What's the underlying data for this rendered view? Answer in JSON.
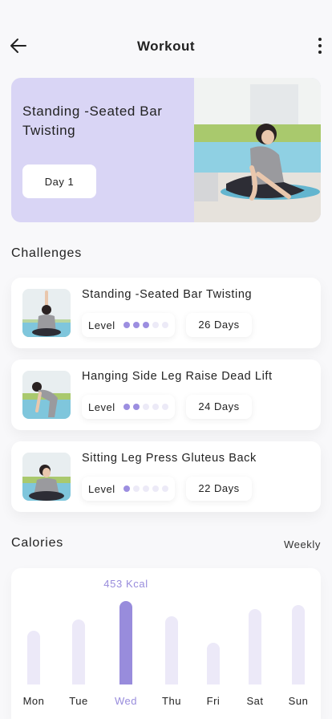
{
  "header": {
    "title": "Workout",
    "back_icon": "arrow-left-icon",
    "menu_icon": "more-vertical-icon"
  },
  "hero": {
    "title": "Standing -Seated Bar Twisting",
    "button_label": "Day 1",
    "color": "#d9d5f5"
  },
  "challenges": {
    "title": "Challenges",
    "level_label": "Level",
    "items": [
      {
        "name": "Standing -Seated Bar Twisting",
        "level": 3,
        "max_level": 5,
        "days": "26 Days"
      },
      {
        "name": "Hanging Side Leg Raise Dead Lift",
        "level": 2,
        "max_level": 5,
        "days": "24 Days"
      },
      {
        "name": "Sitting Leg Press Gluteus Back",
        "level": 1,
        "max_level": 5,
        "days": "22 Days"
      }
    ]
  },
  "calories": {
    "title": "Calories",
    "period": "Weekly",
    "highlight_label": "453 Kcal",
    "accent": "#988cdc"
  },
  "chart_data": {
    "type": "bar",
    "categories": [
      "Mon",
      "Tue",
      "Wed",
      "Thu",
      "Fri",
      "Sat",
      "Sun"
    ],
    "values": [
      0.64,
      0.78,
      1.0,
      0.82,
      0.5,
      0.9,
      0.95
    ],
    "highlight_index": 2,
    "highlight_value_label": "453 Kcal"
  }
}
